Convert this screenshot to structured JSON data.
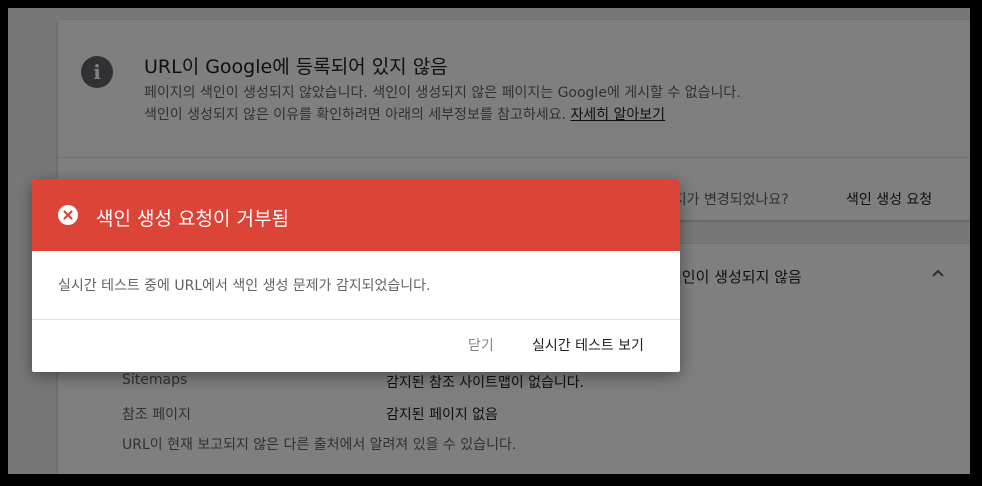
{
  "status_card": {
    "icon": "info-icon",
    "title": "URL이 Google에 등록되어 있지 않음",
    "description": "페이지의 색인이 생성되지 않았습니다. 색인이 생성되지 않은 페이지는 Google에 게시할 수 없습니다. 색인이 생성되지 않은 이유를 확인하려면 아래의 세부정보를 참고하세요. ",
    "learn_more": "자세히 알아보기",
    "changed_question": "페이지가 변경되었나요?",
    "request_indexing": "색인 생성 요청"
  },
  "coverage_card": {
    "status": "색인이 생성되지 않음",
    "rows": [
      {
        "label": "Sitemaps",
        "value": "감지된 참조 사이트맵이 없습니다."
      },
      {
        "label": "참조 페이지",
        "value": "감지된 페이지 없음"
      }
    ],
    "note": "URL이 현재 보고되지 않은 다른 출처에서 알려져 있을 수 있습니다."
  },
  "dialog": {
    "icon": "error-circle-icon",
    "title": "색인 생성 요청이 거부됨",
    "body": "실시간 테스트 중에 URL에서 색인 생성 문제가 감지되었습니다.",
    "close_label": "닫기",
    "live_test_label": "실시간 테스트 보기"
  },
  "colors": {
    "header_red": "#db4437",
    "scrim": "rgba(0,0,0,0.5)"
  }
}
